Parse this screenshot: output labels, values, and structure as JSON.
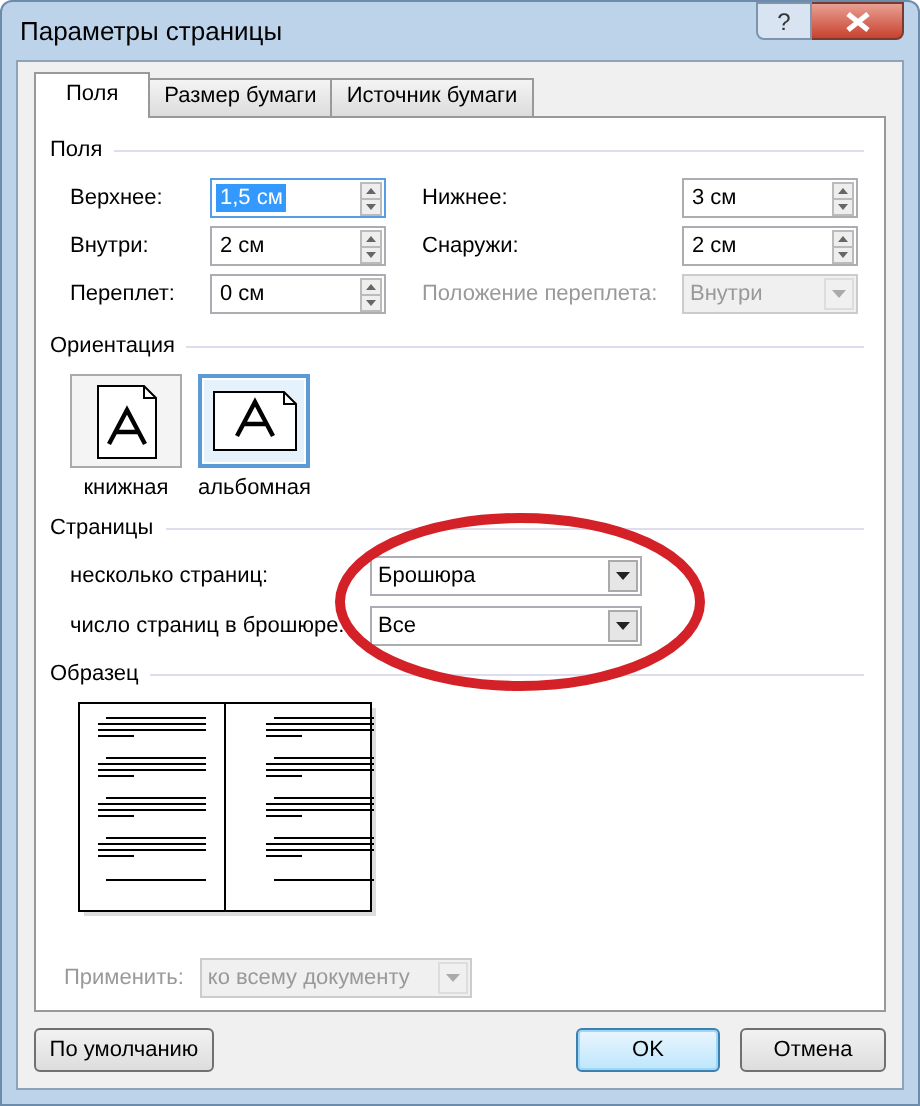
{
  "window": {
    "title": "Параметры страницы",
    "help": "?"
  },
  "tabs": [
    {
      "label": "Поля",
      "selected": true
    },
    {
      "label": "Размер бумаги",
      "selected": false
    },
    {
      "label": "Источник бумаги",
      "selected": false
    }
  ],
  "margins": {
    "title": "Поля",
    "fields": [
      {
        "label": "Верхнее:",
        "value": "1,5 см",
        "kind": "spin",
        "selected": true,
        "disabled": false
      },
      {
        "label": "Нижнее:",
        "value": "3 см",
        "kind": "spin",
        "selected": false,
        "disabled": false
      },
      {
        "label": "Внутри:",
        "value": "2 см",
        "kind": "spin",
        "selected": false,
        "disabled": false
      },
      {
        "label": "Снаружи:",
        "value": "2 см",
        "kind": "spin",
        "selected": false,
        "disabled": false
      },
      {
        "label": "Переплет:",
        "value": "0 см",
        "kind": "spin",
        "selected": false,
        "disabled": false
      },
      {
        "label": "Положение переплета:",
        "value": "Внутри",
        "kind": "dropdown",
        "selected": false,
        "disabled": true
      }
    ]
  },
  "orientation": {
    "title": "Ориентация",
    "options": [
      {
        "label": "книжная",
        "kind": "portrait",
        "selected": false
      },
      {
        "label": "альбомная",
        "kind": "landscape",
        "selected": true
      }
    ]
  },
  "pages": {
    "title": "Страницы",
    "fields": [
      {
        "label": "несколько страниц:",
        "value": "Брошюра"
      },
      {
        "label": "число страниц в брошюре:",
        "value": "Все"
      }
    ]
  },
  "sample": {
    "title": "Образец"
  },
  "apply": {
    "label": "Применить:",
    "value": "ко всему документу",
    "disabled": true
  },
  "buttons": [
    {
      "label": "По умолчанию",
      "default": false
    },
    {
      "label": "OK",
      "default": true
    },
    {
      "label": "Отмена",
      "default": false
    }
  ],
  "annotation": {
    "color": "#d42027"
  }
}
